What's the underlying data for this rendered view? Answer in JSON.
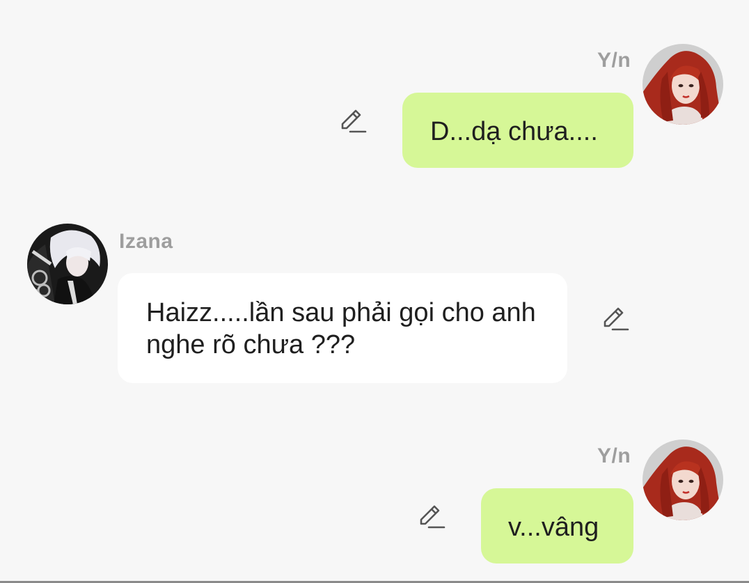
{
  "messages": [
    {
      "sender": "Y/n",
      "side": "right",
      "text": "D...dạ chưa....",
      "avatar_icon": "red-haired-girl-avatar"
    },
    {
      "sender": "Izana",
      "side": "left",
      "text": "Haizz.....lần sau phải gọi cho anh nghe rõ chưa ???",
      "avatar_icon": "white-haired-boy-avatar"
    },
    {
      "sender": "Y/n",
      "side": "right",
      "text": "v...vâng",
      "avatar_icon": "red-haired-girl-avatar"
    }
  ],
  "icons": {
    "edit": "pencil-edit-icon"
  },
  "colors": {
    "background": "#f7f7f7",
    "my_bubble": "#d6f797",
    "their_bubble": "#ffffff",
    "name_text": "#9e9e9e",
    "message_text": "#1f1f1f"
  }
}
